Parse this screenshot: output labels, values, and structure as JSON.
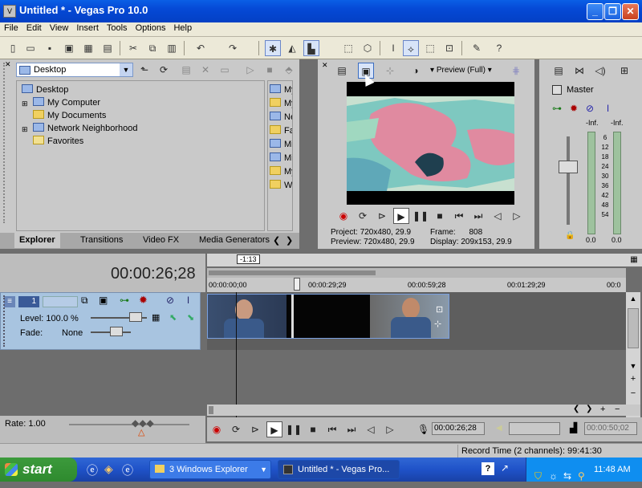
{
  "window": {
    "title": "Untitled * - Vegas Pro 10.0",
    "icon_label": "V"
  },
  "window_buttons": {
    "minimize": "_",
    "maximize": "❐",
    "close": "✕"
  },
  "menu": [
    "File",
    "Edit",
    "View",
    "Insert",
    "Tools",
    "Options",
    "Help"
  ],
  "explorer": {
    "location": "Desktop",
    "tree": [
      "Desktop",
      "My Computer",
      "My Documents",
      "Network Neighborhood",
      "Favorites"
    ],
    "list_items": [
      "My",
      "My",
      "Ne",
      "Fa",
      "Mi",
      "Mi",
      "My",
      "Wi"
    ]
  },
  "bottom_tabs": [
    "Explorer",
    "Transitions",
    "Video FX",
    "Media Generators"
  ],
  "preview": {
    "mode_label": "Preview (Full)",
    "project_label": "Project:",
    "project_value": "720x480, 29.9",
    "preview_label": "Preview:",
    "preview_value": "720x480, 29.9",
    "frame_label": "Frame:",
    "frame_value": "808",
    "display_label": "Display:",
    "display_value": "209x153, 29.9"
  },
  "mixer": {
    "master_label": "Master",
    "left_inf": "-Inf.",
    "right_inf": "-Inf.",
    "scale": [
      "6",
      "12",
      "18",
      "24",
      "30",
      "36",
      "42",
      "48",
      "54"
    ],
    "left_value": "0.0",
    "right_value": "0.0"
  },
  "timeline": {
    "timecode": "00:00:26;28",
    "marker_label": "-1:13",
    "ruler": [
      "00:00:00;00",
      "00:00:29;29",
      "00:00:59;28",
      "00:01:29;29",
      "00:0"
    ],
    "end_timecode": "00:00:50;02"
  },
  "track": {
    "number": "1",
    "level_label": "Level: 100.0 %",
    "fade_label": "Fade:",
    "fade_value": "None"
  },
  "rate_label": "Rate: 1.00",
  "record_time": "Record Time (2 channels): 99:41:30",
  "taskbar": {
    "start": "start",
    "buttons": [
      "3 Windows Explorer",
      "Untitled * - Vegas Pro..."
    ],
    "clock": "11:48 AM"
  }
}
